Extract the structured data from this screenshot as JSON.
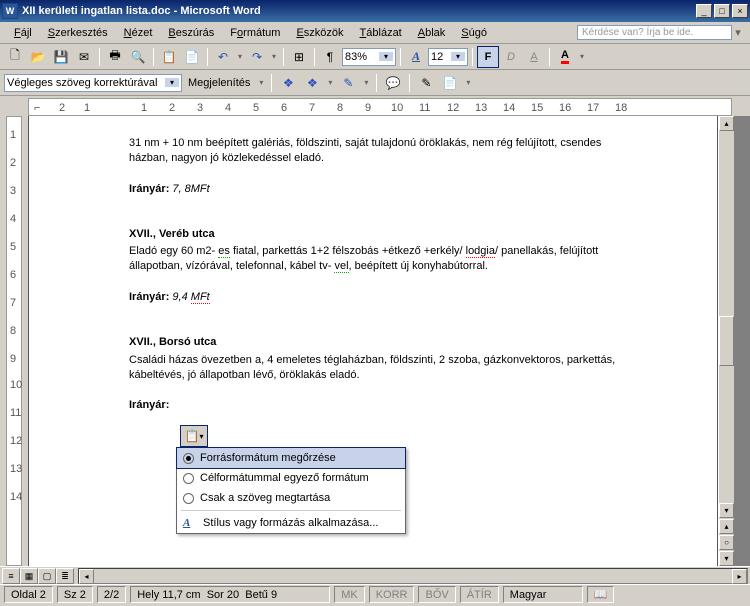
{
  "title": "XII kerületi ingatlan lista.doc - Microsoft Word",
  "menu": {
    "file": "Fájl",
    "edit": "Szerkesztés",
    "view": "Nézet",
    "insert": "Beszúrás",
    "format": "Formátum",
    "tools": "Eszközök",
    "table": "Táblázat",
    "window": "Ablak",
    "help": "Súgó"
  },
  "askbox": "Kérdése van? Írja be ide.",
  "zoom": "83%",
  "fontsize": "12",
  "review_combo": "Végleges szöveg korrektúrával",
  "show_label": "Megjelenítés",
  "doc": {
    "p1": "31 nm + 10 nm beépített galériás, földszinti, saját tulajdonú öröklakás, nem rég felújított, csendes házban, nagyon jó közlekedéssel eladó.",
    "p1_price_label": "Irányár:",
    "p1_price": "7, 8MFt",
    "h2": "XVII., Veréb utca",
    "p2a": "Eladó egy 60 m2-",
    "p2_es": "es",
    "p2b": " fiatal, parkettás 1+2 félszobás +étkező +erkély/ ",
    "p2_lodgia": "lodgia",
    "p2c": "/ panellakás, felújított állapotban, vízórával, telefonnal, kábel tv-",
    "p2_vel": "vel",
    "p2d": ", beépített új konyhabútorral.",
    "p2_price_label": "Irányár:",
    "p2_price_a": "9,4 ",
    "p2_price_b": "MFt",
    "h3": "XVII., Borsó utca",
    "p3": "Családi házas övezetben a, 4 emeletes téglaházban, földszinti, 2 szoba, gázkonvektoros, parkettás, kábeltévés, jó állapotban lévő, öröklakás eladó.",
    "p3_price_label": "Irányár:"
  },
  "paste_menu": {
    "opt1": "Forrásformátum megőrzése",
    "opt2": "Célformátummal egyező formátum",
    "opt3": "Csak a szöveg megtartása",
    "opt4": "Stílus vagy formázás alkalmazása..."
  },
  "status": {
    "page": "Oldal",
    "page_n": "2",
    "sec": "Sz",
    "sec_n": "2",
    "pages": "2/2",
    "pos": "Hely",
    "pos_v": "11,7 cm",
    "line": "Sor",
    "line_v": "20",
    "col": "Betű",
    "col_v": "9",
    "mk": "MK",
    "korr": "KORR",
    "bov": "BŐV",
    "atir": "ÁTÍR",
    "lang": "Magyar"
  }
}
